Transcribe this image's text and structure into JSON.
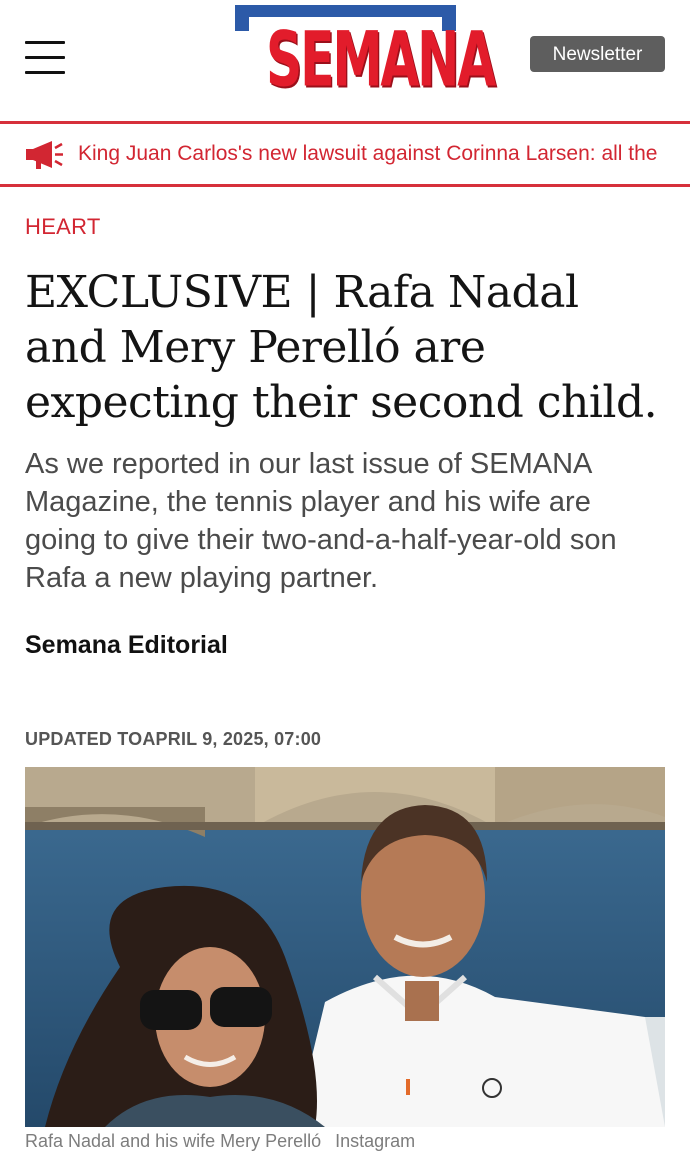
{
  "header": {
    "logo_text": "SEMANA",
    "newsletter_label": "Newsletter",
    "colors": {
      "logo_red": "#e21c2b",
      "logo_blue": "#2c5aa8",
      "button_gray": "#5e5e5e"
    }
  },
  "ticker": {
    "icon": "megaphone-icon",
    "text": "King Juan Carlos's new lawsuit against Corinna Larsen: all the",
    "color": "#d22632"
  },
  "article": {
    "section": "HEART",
    "headline": "EXCLUSIVE | Rafa Nadal and Mery Perelló are expecting their second child.",
    "subhead": "As we reported in our last issue of SEMANA Magazine, the tennis player and his wife are going to give their two-and-a-half-year-old son Rafa a new playing partner.",
    "author": "Semana Editorial",
    "updated": "UPDATED TOAPRIL 9, 2025, 07:00",
    "photo": {
      "caption": "Rafa Nadal and his wife Mery Perelló",
      "credit": "Instagram"
    }
  }
}
